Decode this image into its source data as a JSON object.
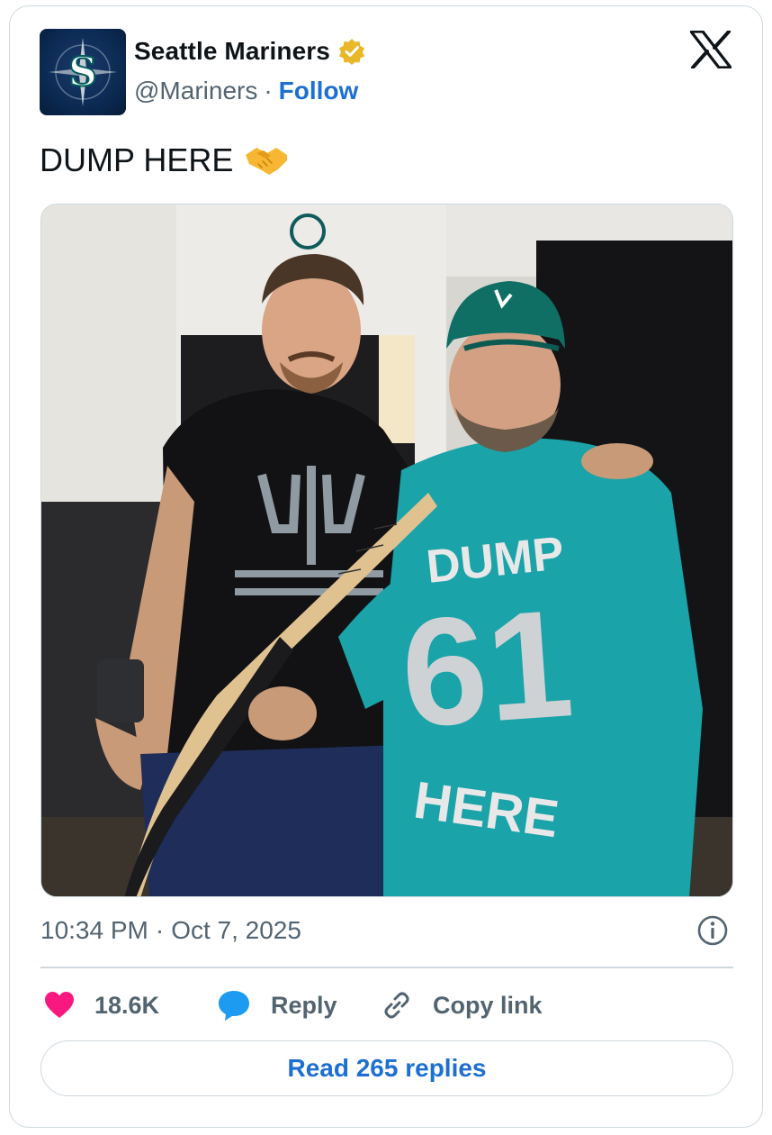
{
  "author": {
    "name": "Seattle Mariners",
    "handle": "@Mariners",
    "separator": "·",
    "follow_label": "Follow",
    "verified_badge_color": "#e8b829",
    "avatar_icon": "mariners-compass-s-logo"
  },
  "platform_icon": "x-logo",
  "tweet": {
    "text": "DUMP HERE",
    "emoji": "handshake-emoji",
    "photo_icon": "photo-two-men-holding-bat"
  },
  "meta": {
    "time": "10:34 PM",
    "separator": "·",
    "date": "Oct 7, 2025",
    "info_icon": "info-icon"
  },
  "actions": {
    "likes_count": "18.6K",
    "reply_label": "Reply",
    "copy_link_label": "Copy link",
    "like_color": "#f91880",
    "reply_color": "#1d9bf0"
  },
  "read_replies_label": "Read 265 replies",
  "colors": {
    "accent": "#1d6fd1",
    "muted": "#536471",
    "border": "#cfd9de"
  }
}
